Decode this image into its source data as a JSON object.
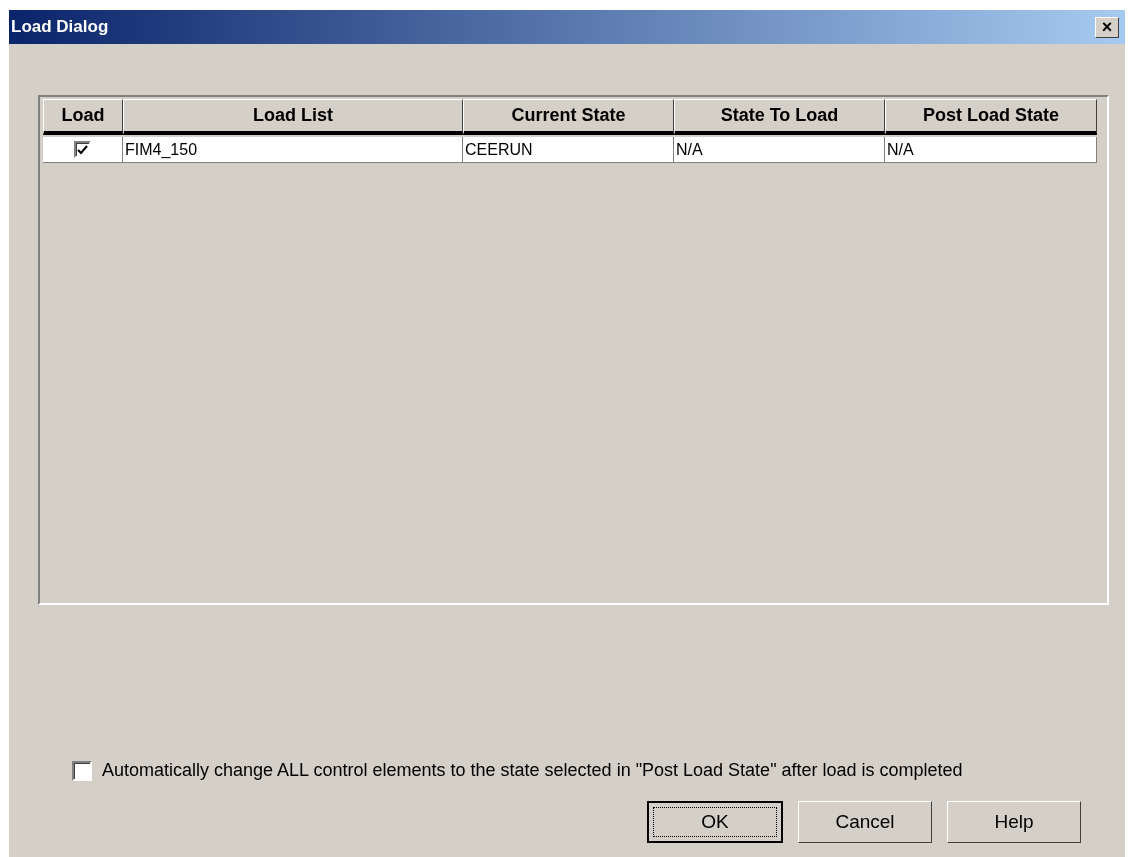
{
  "window": {
    "title": "Load Dialog",
    "close": "×"
  },
  "table": {
    "columns": [
      {
        "label": "Load"
      },
      {
        "label": "Load List"
      },
      {
        "label": "Current State"
      },
      {
        "label": "State To Load"
      },
      {
        "label": "Post Load State"
      }
    ],
    "rows": [
      {
        "load_checked": true,
        "load_list": "FIM4_150",
        "current_state": "CEERUN",
        "state_to_load": "N/A",
        "post_load_state": "N/A"
      }
    ]
  },
  "auto_change": {
    "label": "Automatically change ALL control elements to the state selected in \"Post Load State\" after load is completed",
    "checked": false
  },
  "buttons": [
    {
      "label": "OK",
      "kind": "default"
    },
    {
      "label": "Cancel",
      "kind": "normal"
    },
    {
      "label": "Help",
      "kind": "normal"
    }
  ]
}
